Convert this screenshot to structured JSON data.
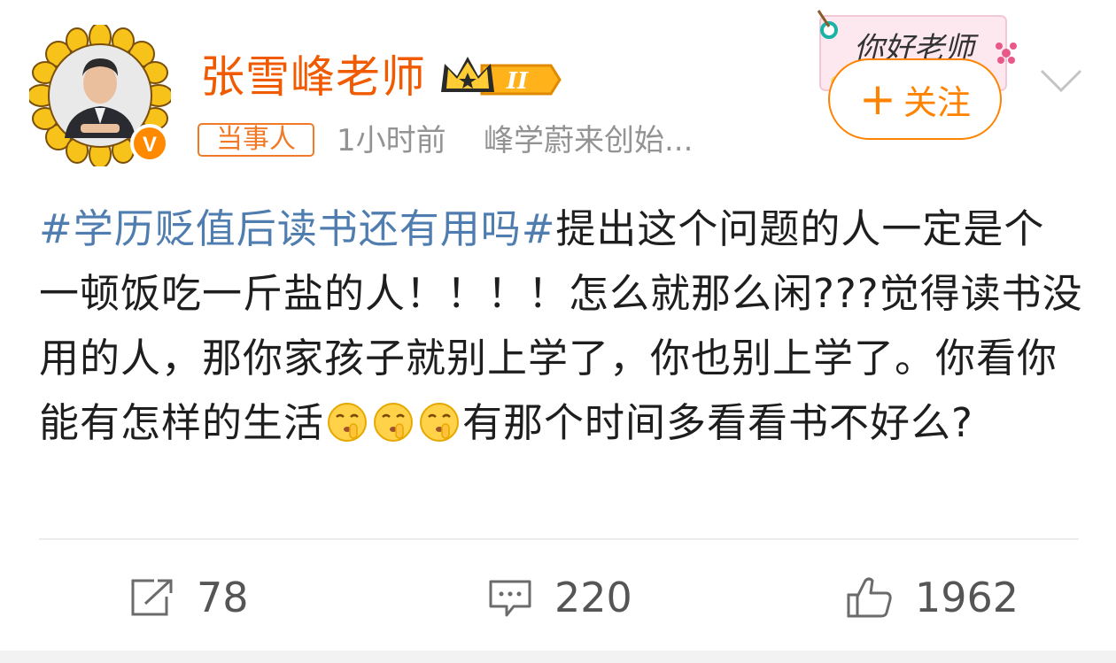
{
  "author": {
    "name": "张雪峰老师",
    "level_badge": "II",
    "tag": "当事人",
    "time": "1小时前",
    "source": "峰学蔚来创始..."
  },
  "card_decoration": {
    "text": "你好老师"
  },
  "follow_button": {
    "plus": "+",
    "label": "关注"
  },
  "post": {
    "hashtag": "#学历贬值后读书还有用吗#",
    "text_part1": "提出这个问题的人一定是个一顿饭吃一斤盐的人！！！！怎么就那么闲???觉得读书没用的人，那你家孩子就别上学了，你也别上学了。你看你能有怎样的生活",
    "text_part2": "有那个时间多看看书不好么?",
    "emoji_name": "shush-emoji"
  },
  "actions": {
    "repost_count": "78",
    "comment_count": "220",
    "like_count": "1962"
  },
  "colors": {
    "name": "#f05a00",
    "hashtag": "#507daf",
    "follow": "#ff8200",
    "meta": "#939393"
  }
}
